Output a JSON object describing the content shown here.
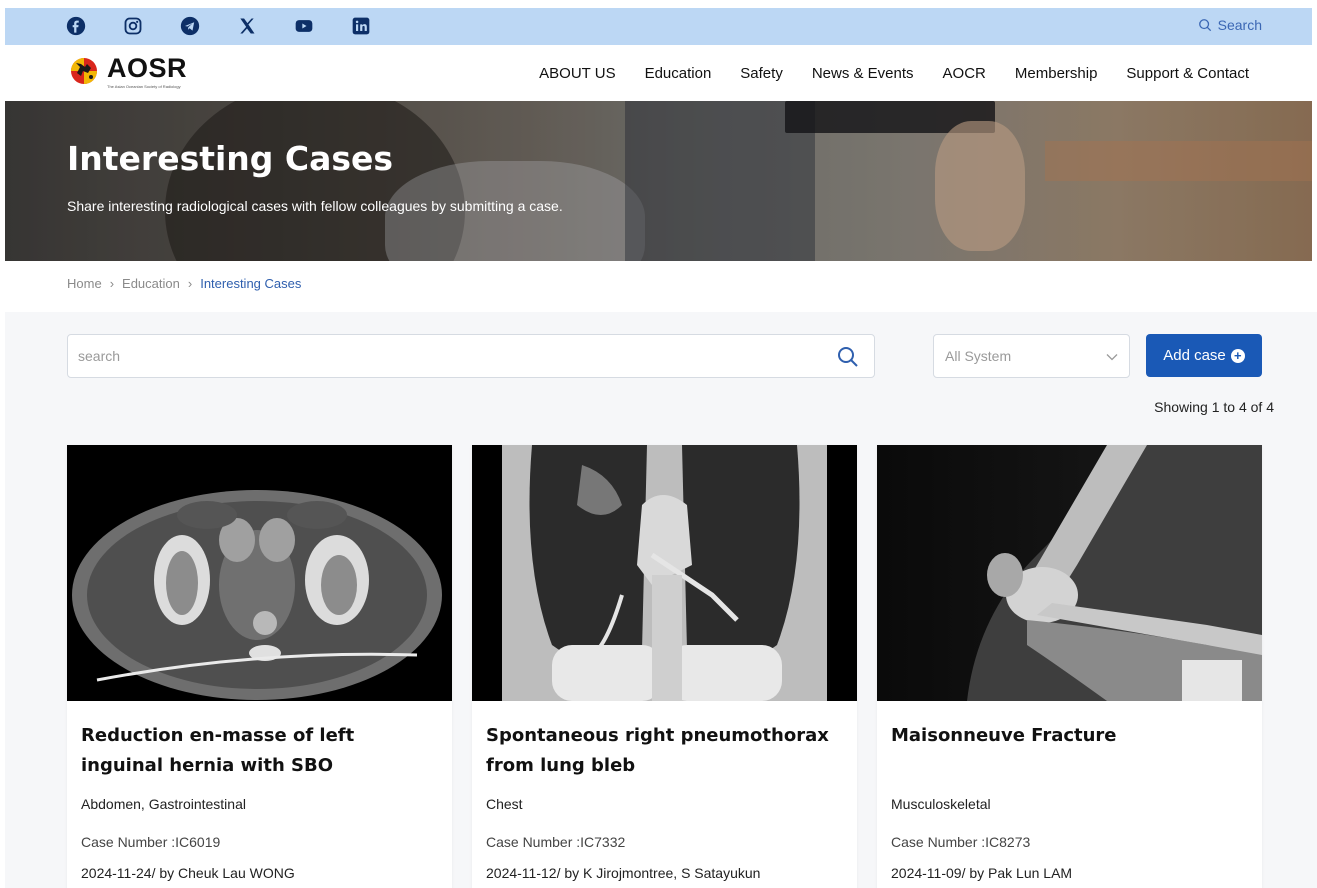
{
  "social_icons": [
    "facebook-icon",
    "instagram-icon",
    "telegram-icon",
    "x-icon",
    "youtube-icon",
    "linkedin-icon"
  ],
  "top_search_label": "Search",
  "logo": {
    "text": "AOSR",
    "subtitle": "The Asian Oceanian Society of Radiology"
  },
  "nav": [
    "ABOUT US",
    "Education",
    "Safety",
    "News & Events",
    "AOCR",
    "Membership",
    "Support & Contact"
  ],
  "hero": {
    "title": "Interesting Cases",
    "subtitle": "Share interesting radiological cases with fellow colleagues by submitting a case."
  },
  "breadcrumb": [
    "Home",
    "Education",
    "Interesting Cases"
  ],
  "search": {
    "placeholder": "search",
    "value": ""
  },
  "system_filter": {
    "selected": "All System"
  },
  "add_case_label": "Add case",
  "showing_text": "Showing 1 to 4 of 4",
  "cards": [
    {
      "title": "Reduction en-masse of left inguinal hernia with SBO",
      "system": "Abdomen, Gastrointestinal",
      "case_number": "Case Number :IC6019",
      "date_author": "2024-11-24/ by Cheuk Lau WONG",
      "image": "ct-pelvis-axial"
    },
    {
      "title": "Spontaneous right pneumothorax from lung bleb",
      "system": "Chest",
      "case_number": "Case Number :IC7332",
      "date_author": "2024-11-12/ by K Jirojmontree, S Satayukun",
      "image": "ct-chest-coronal"
    },
    {
      "title": "Maisonneuve Fracture",
      "system": "Musculoskeletal",
      "case_number": "Case Number :IC8273",
      "date_author": "2024-11-09/ by Pak Lun LAM",
      "image": "xray-knee-lateral"
    }
  ],
  "colors": {
    "accent": "#1a59b6",
    "topbar": "#bcd7f4",
    "link": "#2f5fae"
  }
}
